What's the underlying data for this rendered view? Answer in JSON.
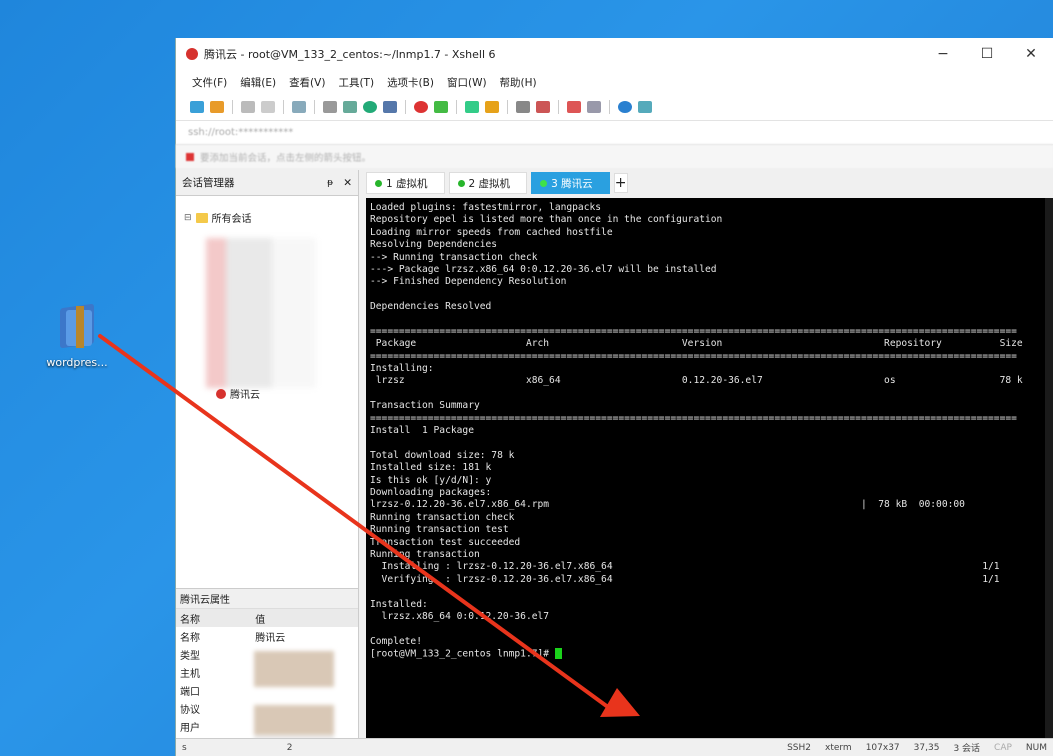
{
  "desktop": {
    "icon_label": "wordpres..."
  },
  "window": {
    "title": "腾讯云 - root@VM_133_2_centos:~/lnmp1.7 - Xshell 6",
    "controls": {
      "minimize": "−",
      "maximize": "☐",
      "close": "✕"
    }
  },
  "menu": [
    "文件(F)",
    "编辑(E)",
    "查看(V)",
    "工具(T)",
    "选项卡(B)",
    "窗口(W)",
    "帮助(H)"
  ],
  "address": {
    "value": "ssh://root:***********"
  },
  "hint": "要添加当前会话，点击左侧的箭头按钮。",
  "session_panel": {
    "title": "会话管理器",
    "pin": "ᵽ",
    "close": "✕",
    "root": "所有会话",
    "item": "腾讯云",
    "partial_item": "虚拟机"
  },
  "properties": {
    "title": "腾讯云属性",
    "header": {
      "name": "名称",
      "value": "值"
    },
    "rows": [
      {
        "name": "名称",
        "value": "腾讯云"
      },
      {
        "name": "类型",
        "value": ""
      },
      {
        "name": "主机",
        "value": ""
      },
      {
        "name": "端口",
        "value": ""
      },
      {
        "name": "协议",
        "value": ""
      },
      {
        "name": "用户",
        "value": ""
      }
    ]
  },
  "tabs": [
    {
      "label": "1 虚拟机",
      "active": false
    },
    {
      "label": "2 虚拟机",
      "active": false
    },
    {
      "label": "3 腾讯云",
      "active": true
    }
  ],
  "terminal": {
    "lines": [
      "Loaded plugins: fastestmirror, langpacks",
      "Repository epel is listed more than once in the configuration",
      "Loading mirror speeds from cached hostfile",
      "Resolving Dependencies",
      "--> Running transaction check",
      "---> Package lrzsz.x86_64 0:0.12.20-36.el7 will be installed",
      "--> Finished Dependency Resolution",
      "",
      "Dependencies Resolved",
      "",
      "================================================================================================================",
      " Package                   Arch                       Version                            Repository          Size",
      "================================================================================================================",
      "Installing:",
      " lrzsz                     x86_64                     0.12.20-36.el7                     os                  78 k",
      "",
      "Transaction Summary",
      "================================================================================================================",
      "Install  1 Package",
      "",
      "Total download size: 78 k",
      "Installed size: 181 k",
      "Is this ok [y/d/N]: y",
      "Downloading packages:",
      "lrzsz-0.12.20-36.el7.x86_64.rpm                                                      |  78 kB  00:00:00",
      "Running transaction check",
      "Running transaction test",
      "Transaction test succeeded",
      "Running transaction",
      "  Installing : lrzsz-0.12.20-36.el7.x86_64                                                                1/1",
      "  Verifying  : lrzsz-0.12.20-36.el7.x86_64                                                                1/1",
      "",
      "Installed:",
      "  lrzsz.x86_64 0:0.12.20-36.el7",
      "",
      "Complete!"
    ],
    "prompt": "[root@VM_133_2_centos lnmp1.7]# "
  },
  "status": {
    "left": "s",
    "left_num": "2",
    "items": [
      "SSH2",
      "xterm",
      "107x37",
      "37,35",
      "3 会话",
      "CAP",
      "NUM"
    ]
  },
  "colors": {
    "accent": "#2aa0e0",
    "arrow": "#e8341c",
    "cursor": "#1bd31b"
  }
}
